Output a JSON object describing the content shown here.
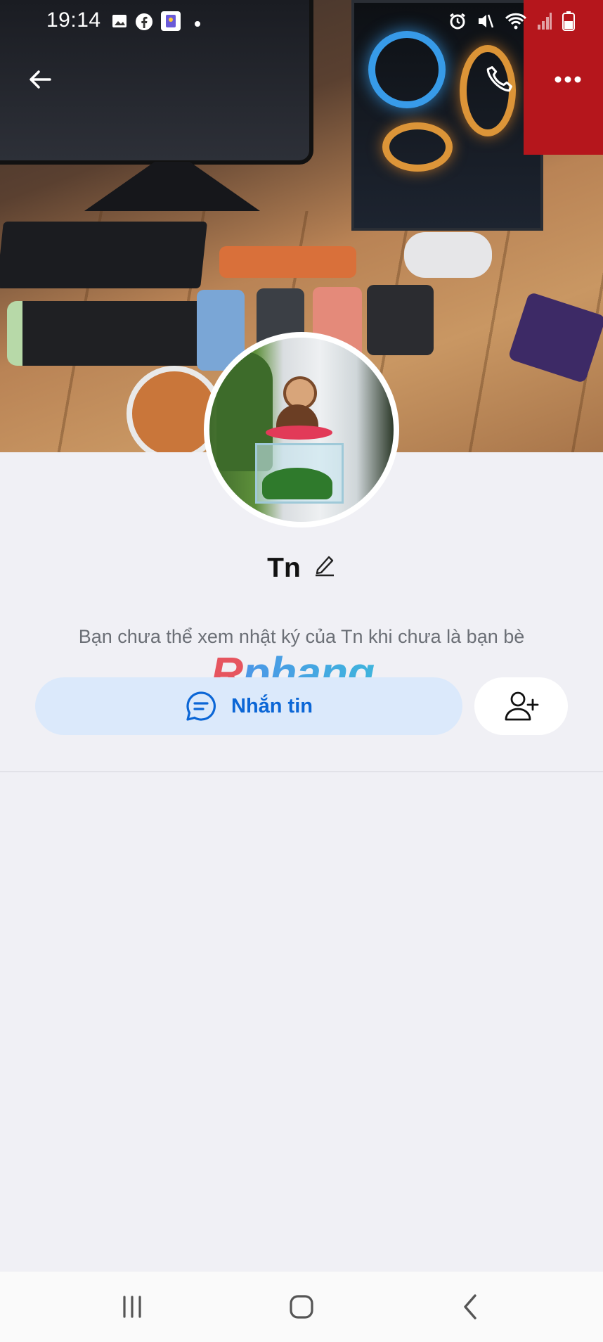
{
  "status_bar": {
    "time": "19:14",
    "left_icons": [
      "gallery-icon",
      "facebook-icon",
      "app-icon",
      "dot-icon"
    ],
    "right_icons": [
      "alarm-icon",
      "mute-icon",
      "wifi-icon",
      "signal-icon",
      "battery-icon"
    ]
  },
  "header": {
    "back_icon": "arrow-left-icon",
    "call_icon": "phone-icon",
    "more_icon": "more-dots-icon"
  },
  "profile": {
    "name": "Tn",
    "edit_icon": "pencil-icon",
    "notice": "Bạn chưa thể xem nhật ký của Tn khi chưa là bạn bè"
  },
  "watermark": "Rphang",
  "actions": {
    "message_label": "Nhắn tin",
    "message_icon": "chat-bubble-icon",
    "add_friend_icon": "add-user-icon"
  },
  "colors": {
    "accent": "#0b66d6",
    "message_bg": "#dbe9fb",
    "page_bg": "#f0f0f5"
  },
  "nav": {
    "recent_icon": "recent-apps-icon",
    "home_icon": "home-icon",
    "back_icon": "back-chevron-icon"
  }
}
